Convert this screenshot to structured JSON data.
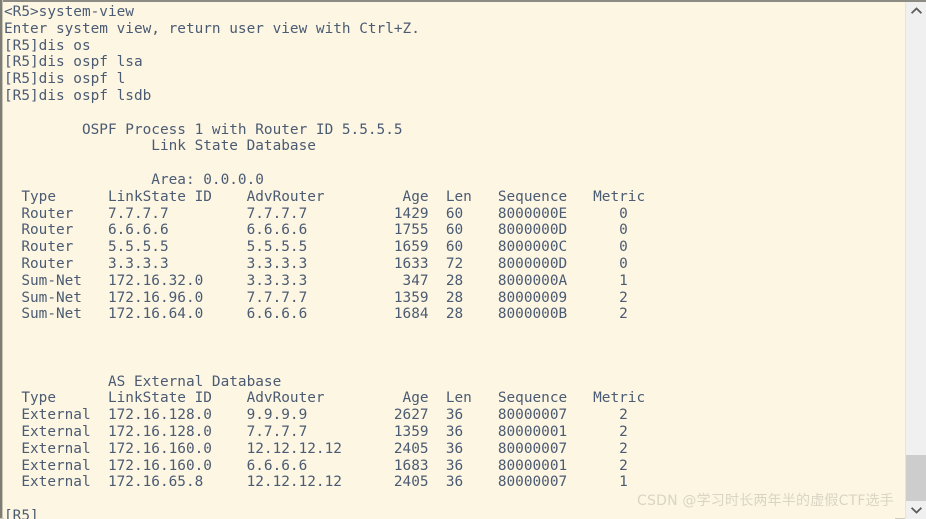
{
  "terminal": {
    "background_color": "#fdf6e3",
    "text_color": "#4a5b73",
    "lines": [
      "<R5>system-view",
      "Enter system view, return user view with Ctrl+Z.",
      "[R5]dis os",
      "[R5]dis ospf lsa",
      "[R5]dis ospf l",
      "[R5]dis ospf lsdb",
      "",
      "         OSPF Process 1 with Router ID 5.5.5.5",
      "                 Link State Database",
      "",
      "                 Area: 0.0.0.0",
      "  Type      LinkState ID    AdvRouter         Age  Len   Sequence   Metric",
      "  Router    7.7.7.7         7.7.7.7          1429  60    8000000E      0",
      "  Router    6.6.6.6         6.6.6.6          1755  60    8000000D      0",
      "  Router    5.5.5.5         5.5.5.5          1659  60    8000000C      0",
      "  Router    3.3.3.3         3.3.3.3          1633  72    8000000D      0",
      "  Sum-Net   172.16.32.0     3.3.3.3           347  28    8000000A      1",
      "  Sum-Net   172.16.96.0     7.7.7.7          1359  28    80000009      2",
      "  Sum-Net   172.16.64.0     6.6.6.6          1684  28    8000000B      2",
      "",
      "",
      "",
      "            AS External Database",
      "  Type      LinkState ID    AdvRouter         Age  Len   Sequence   Metric",
      "  External  172.16.128.0    9.9.9.9          2627  36    80000007      2",
      "  External  172.16.128.0    7.7.7.7          1359  36    80000001      2",
      "  External  172.16.160.0    12.12.12.12      2405  36    80000007      2",
      "  External  172.16.160.0    6.6.6.6          1683  36    80000001      2",
      "  External  172.16.65.8     12.12.12.12      2405  36    80000007      1",
      "",
      "[R5]"
    ]
  },
  "session": {
    "prompt_user_mode": "<R5>",
    "prompt_system_mode": "[R5]",
    "commands": [
      "system-view",
      "dis os",
      "dis ospf lsa",
      "dis ospf l",
      "dis ospf lsdb"
    ],
    "notice": "Enter system view, return user view with Ctrl+Z."
  },
  "ospf": {
    "process_header": "OSPF Process 1 with Router ID 5.5.5.5",
    "database_title": "Link State Database",
    "process_id": "1",
    "router_id": "5.5.5.5",
    "area_label": "Area: 0.0.0.0",
    "external_title": "AS External Database",
    "columns": [
      "Type",
      "LinkState ID",
      "AdvRouter",
      "Age",
      "Len",
      "Sequence",
      "Metric"
    ],
    "area_rows": [
      {
        "type": "Router",
        "linkstate_id": "7.7.7.7",
        "adv_router": "7.7.7.7",
        "age": "1429",
        "len": "60",
        "sequence": "8000000E",
        "metric": "0"
      },
      {
        "type": "Router",
        "linkstate_id": "6.6.6.6",
        "adv_router": "6.6.6.6",
        "age": "1755",
        "len": "60",
        "sequence": "8000000D",
        "metric": "0"
      },
      {
        "type": "Router",
        "linkstate_id": "5.5.5.5",
        "adv_router": "5.5.5.5",
        "age": "1659",
        "len": "60",
        "sequence": "8000000C",
        "metric": "0"
      },
      {
        "type": "Router",
        "linkstate_id": "3.3.3.3",
        "adv_router": "3.3.3.3",
        "age": "1633",
        "len": "72",
        "sequence": "8000000D",
        "metric": "0"
      },
      {
        "type": "Sum-Net",
        "linkstate_id": "172.16.32.0",
        "adv_router": "3.3.3.3",
        "age": "347",
        "len": "28",
        "sequence": "8000000A",
        "metric": "1"
      },
      {
        "type": "Sum-Net",
        "linkstate_id": "172.16.96.0",
        "adv_router": "7.7.7.7",
        "age": "1359",
        "len": "28",
        "sequence": "80000009",
        "metric": "2"
      },
      {
        "type": "Sum-Net",
        "linkstate_id": "172.16.64.0",
        "adv_router": "6.6.6.6",
        "age": "1684",
        "len": "28",
        "sequence": "8000000B",
        "metric": "2"
      }
    ],
    "external_rows": [
      {
        "type": "External",
        "linkstate_id": "172.16.128.0",
        "adv_router": "9.9.9.9",
        "age": "2627",
        "len": "36",
        "sequence": "80000007",
        "metric": "2"
      },
      {
        "type": "External",
        "linkstate_id": "172.16.128.0",
        "adv_router": "7.7.7.7",
        "age": "1359",
        "len": "36",
        "sequence": "80000001",
        "metric": "2"
      },
      {
        "type": "External",
        "linkstate_id": "172.16.160.0",
        "adv_router": "12.12.12.12",
        "age": "2405",
        "len": "36",
        "sequence": "80000007",
        "metric": "2"
      },
      {
        "type": "External",
        "linkstate_id": "172.16.160.0",
        "adv_router": "6.6.6.6",
        "age": "1683",
        "len": "36",
        "sequence": "80000001",
        "metric": "2"
      },
      {
        "type": "External",
        "linkstate_id": "172.16.65.8",
        "adv_router": "12.12.12.12",
        "age": "2405",
        "len": "36",
        "sequence": "80000007",
        "metric": "1"
      }
    ]
  },
  "scrollbar": {
    "up_arrow_icon": "chevron-up-icon",
    "down_arrow_icon": "chevron-down-icon",
    "thumb_color": "#cdcdcd",
    "track_color": "#f0f0f0"
  },
  "watermark": {
    "text": "CSDN @学习时长两年半的虚假CTF选手",
    "color": "#d9d4c4"
  }
}
